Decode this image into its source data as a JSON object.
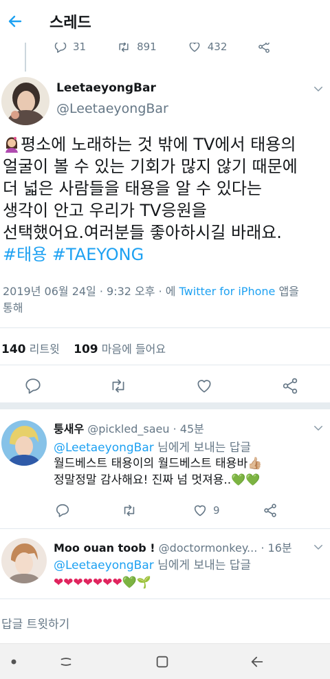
{
  "header": {
    "title": "스레드"
  },
  "previous_tweet": {
    "replies": "31",
    "retweets": "891",
    "likes": "432"
  },
  "main_tweet": {
    "display_name": "LeetaeyongBar",
    "handle": "@LeetaeyongBar",
    "text_lines": [
      "평소에 노래하는 것 밖에 TV에서 태용의",
      "얼굴이 볼 수 있는 기회가 많지 않기 때문에",
      "더 넓은 사람들을 태용을 알 수 있다는",
      "생각이 안고 우리가 TV응원을",
      "선택했어요.여러분들 좋아하시길 바래요."
    ],
    "hashtags": "#태용 #TAEYONG",
    "meta_prefix": "2019년 06월 24일 · 9:32 오후 · 에 ",
    "meta_link": "Twitter for iPhone",
    "meta_suffix_1": " 앱을",
    "meta_suffix_2": "통해",
    "retweet_count": "140",
    "retweet_label": "리트윗",
    "like_count": "109",
    "like_label": "마음에 들어요"
  },
  "replies": [
    {
      "name": "퉁새우",
      "handle": "@pickled_saeu",
      "time": "· 45분",
      "reply_to_handle": "@LeetaeyongBar",
      "reply_to_suffix": " 님에게 보내는 답글",
      "line1": "월드베스트 태용이의 월드베스트 태용바",
      "line1_tail": "👍🏼",
      "line2": "정말정말 감사해요! 진짜 넘 멋져용..",
      "line2_tail": "💚💚",
      "like_count": "9"
    },
    {
      "name": "Moo ouan toob !",
      "handle": "@doctormonkey...",
      "time": "· 16분",
      "reply_to_handle": "@LeetaeyongBar",
      "reply_to_suffix": " 님에게 보내는 답글",
      "red_hearts": "❤❤❤❤❤❤❤",
      "tail_hearts": "💚🌱"
    }
  ],
  "reply_prompt": "답글 트윗하기",
  "colors": {
    "accent": "#1da1f2",
    "secondary_text": "#657786",
    "divider": "#e1e8ed"
  }
}
